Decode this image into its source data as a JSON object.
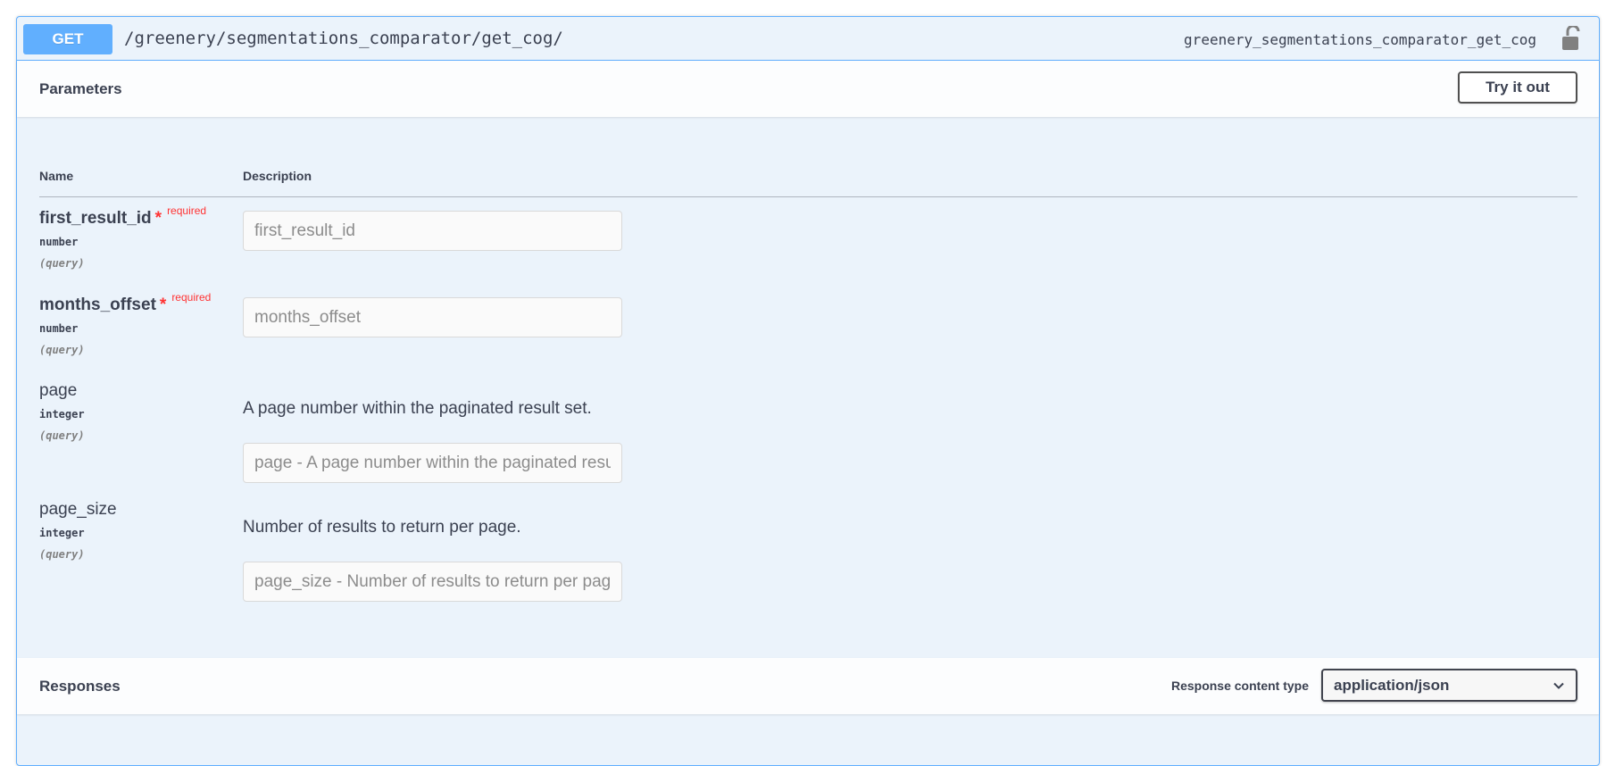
{
  "operation": {
    "method": "GET",
    "path": "/greenery/segmentations_comparator/get_cog/",
    "operation_id": "greenery_segmentations_comparator_get_cog",
    "lock_icon": "unlocked-padlock-icon",
    "accent_color": "#61affe"
  },
  "parameters_section": {
    "title": "Parameters",
    "try_button_label": "Try it out",
    "column_name": "Name",
    "column_description": "Description"
  },
  "params": [
    {
      "name": "first_result_id",
      "required_star": "*",
      "required_label": "required",
      "type": "number",
      "in": "(query)",
      "description": "",
      "placeholder": "first_result_id"
    },
    {
      "name": "months_offset",
      "required_star": "*",
      "required_label": "required",
      "type": "number",
      "in": "(query)",
      "description": "",
      "placeholder": "months_offset"
    },
    {
      "name": "page",
      "type": "integer",
      "in": "(query)",
      "description": "A page number within the paginated result set.",
      "placeholder": "page - A page number within the paginated result set."
    },
    {
      "name": "page_size",
      "type": "integer",
      "in": "(query)",
      "description": "Number of results to return per page.",
      "placeholder": "page_size - Number of results to return per page."
    }
  ],
  "responses_section": {
    "title": "Responses",
    "content_type_label": "Response content type",
    "content_type_value": "application/json",
    "chevron_icon": "chevron-down-icon"
  }
}
